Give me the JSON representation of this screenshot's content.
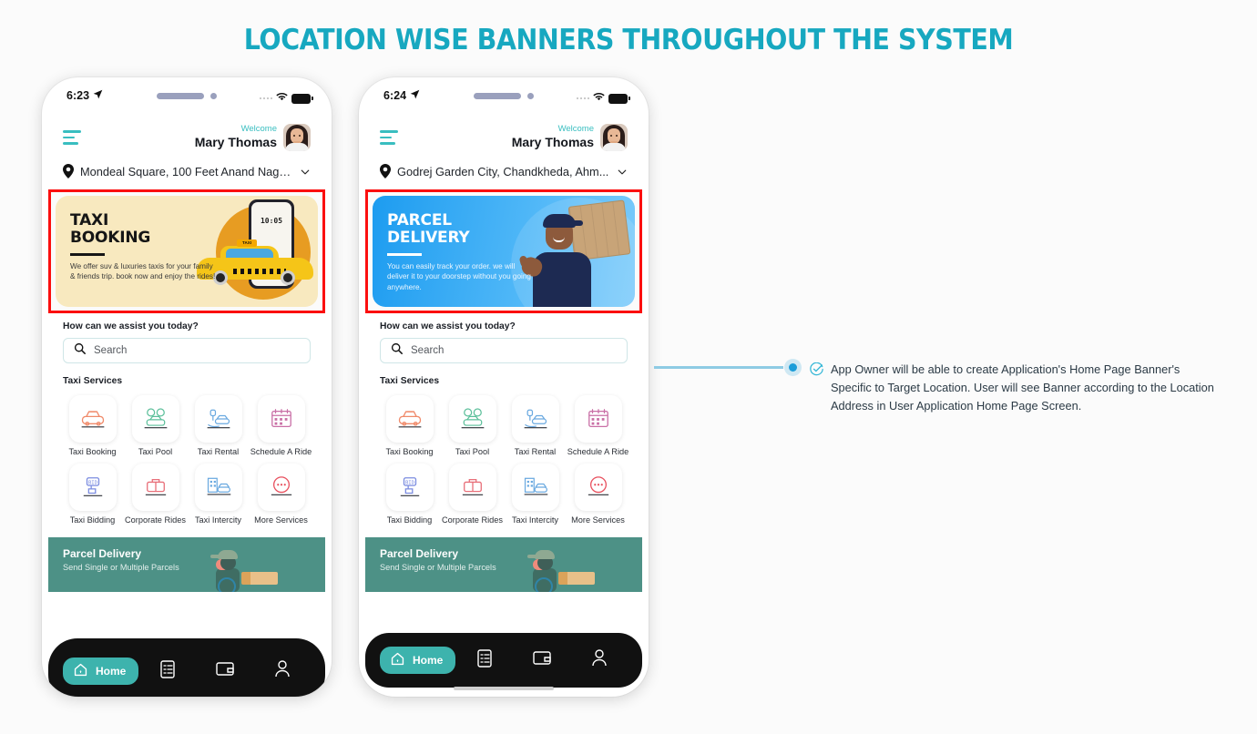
{
  "title": "LOCATION WISE BANNERS THROUGHOUT THE SYSTEM",
  "colors": {
    "title_teal": "#17a8c0",
    "accent_teal": "#39bec0",
    "highlight_red": "#fb0f0f",
    "promo_teal": "#4d9186",
    "nav_black": "#111111",
    "connector_blue": "#8ecbe4"
  },
  "phones": [
    {
      "status": {
        "time": "6:23",
        "location_arrow": "navigation-arrow-icon",
        "signal": "signal-dots-icon",
        "wifi": "wifi-icon",
        "battery": "battery-full-icon"
      },
      "header": {
        "menu": "hamburger-menu-icon",
        "welcome": "Welcome",
        "username": "Mary Thomas",
        "avatar": "user-avatar"
      },
      "location": {
        "pin": "location-pin-icon",
        "address": "Mondeal Square, 100 Feet Anand Naga...",
        "chevron": "chevron-down-icon"
      },
      "banner": {
        "highlighted": true,
        "kind": "taxi",
        "title": "TAXI BOOKING",
        "title_line1": "TAXI",
        "title_line2": "BOOKING",
        "description": "We offer suv & luxuries taxis for your family & friends trip. book now and enjoy the rides!",
        "art": {
          "phone_time": "10:05",
          "taxi_sign": "TAXI"
        }
      },
      "assist_label": "How can we assist you today?",
      "search": {
        "placeholder": "Search",
        "icon": "search-icon"
      },
      "services_title": "Taxi Services",
      "services": [
        {
          "label": "Taxi Booking",
          "icon": "taxi-icon",
          "color": "#f08a6a"
        },
        {
          "label": "Taxi Pool",
          "icon": "car-pool-icon",
          "color": "#5bbf9a"
        },
        {
          "label": "Taxi Rental",
          "icon": "car-key-hand-icon",
          "color": "#6aa9e0"
        },
        {
          "label": "Schedule A Ride",
          "icon": "calendar-icon",
          "color": "#c96fa6"
        },
        {
          "label": "Taxi Bidding",
          "icon": "bid-hand-icon",
          "color": "#7b8ce0"
        },
        {
          "label": "Corporate Rides",
          "icon": "briefcase-icon",
          "color": "#e8707a"
        },
        {
          "label": "Taxi Intercity",
          "icon": "city-car-icon",
          "color": "#6aa9e0"
        },
        {
          "label": "More Services",
          "icon": "more-dots-icon",
          "color": "#e8505e"
        }
      ],
      "promo": {
        "title": "Parcel Delivery",
        "subtitle": "Send Single or Multiple Parcels",
        "art": "courier-scooter-illustration"
      },
      "nav": [
        {
          "label": "Home",
          "icon": "home-icon",
          "active": true
        },
        {
          "label": "",
          "icon": "list-checklist-icon",
          "active": false
        },
        {
          "label": "",
          "icon": "wallet-icon",
          "active": false
        },
        {
          "label": "",
          "icon": "person-icon",
          "active": false
        }
      ],
      "home_indicator": false
    },
    {
      "status": {
        "time": "6:24",
        "location_arrow": "navigation-arrow-icon",
        "signal": "signal-dots-icon",
        "wifi": "wifi-icon",
        "battery": "battery-full-icon"
      },
      "header": {
        "menu": "hamburger-menu-icon",
        "welcome": "Welcome",
        "username": "Mary Thomas",
        "avatar": "user-avatar"
      },
      "location": {
        "pin": "location-pin-icon",
        "address": "Godrej Garden City, Chandkheda, Ahm...",
        "chevron": "chevron-down-icon"
      },
      "banner": {
        "highlighted": true,
        "kind": "parcel",
        "title": "PARCEL DELIVERY",
        "title_line1": "PARCEL",
        "title_line2": "DELIVERY",
        "description": "You can easily track your order. we will deliver it to your doorstep without you going anywhere.",
        "art": {
          "phone_time": "",
          "taxi_sign": ""
        }
      },
      "assist_label": "How can we assist you today?",
      "search": {
        "placeholder": "Search",
        "icon": "search-icon"
      },
      "services_title": "Taxi Services",
      "services": [
        {
          "label": "Taxi Booking",
          "icon": "taxi-icon",
          "color": "#f08a6a"
        },
        {
          "label": "Taxi Pool",
          "icon": "car-pool-icon",
          "color": "#5bbf9a"
        },
        {
          "label": "Taxi Rental",
          "icon": "car-key-hand-icon",
          "color": "#6aa9e0"
        },
        {
          "label": "Schedule A Ride",
          "icon": "calendar-icon",
          "color": "#c96fa6"
        },
        {
          "label": "Taxi Bidding",
          "icon": "bid-hand-icon",
          "color": "#7b8ce0"
        },
        {
          "label": "Corporate Rides",
          "icon": "briefcase-icon",
          "color": "#e8707a"
        },
        {
          "label": "Taxi Intercity",
          "icon": "city-car-icon",
          "color": "#6aa9e0"
        },
        {
          "label": "More Services",
          "icon": "more-dots-icon",
          "color": "#e8505e"
        }
      ],
      "promo": {
        "title": "Parcel Delivery",
        "subtitle": "Send Single or Multiple Parcels",
        "art": "courier-scooter-illustration"
      },
      "nav": [
        {
          "label": "Home",
          "icon": "home-icon",
          "active": true
        },
        {
          "label": "",
          "icon": "list-checklist-icon",
          "active": false
        },
        {
          "label": "",
          "icon": "wallet-icon",
          "active": false
        },
        {
          "label": "",
          "icon": "person-icon",
          "active": false
        }
      ],
      "home_indicator": true
    }
  ],
  "annotation": {
    "marker": "connector-dot",
    "check_icon": "check-circle-icon",
    "text": "App Owner will be able to create Application's Home Page Banner's Specific to Target Location. User will see Banner according to the Location Address in User Application Home Page Screen."
  }
}
